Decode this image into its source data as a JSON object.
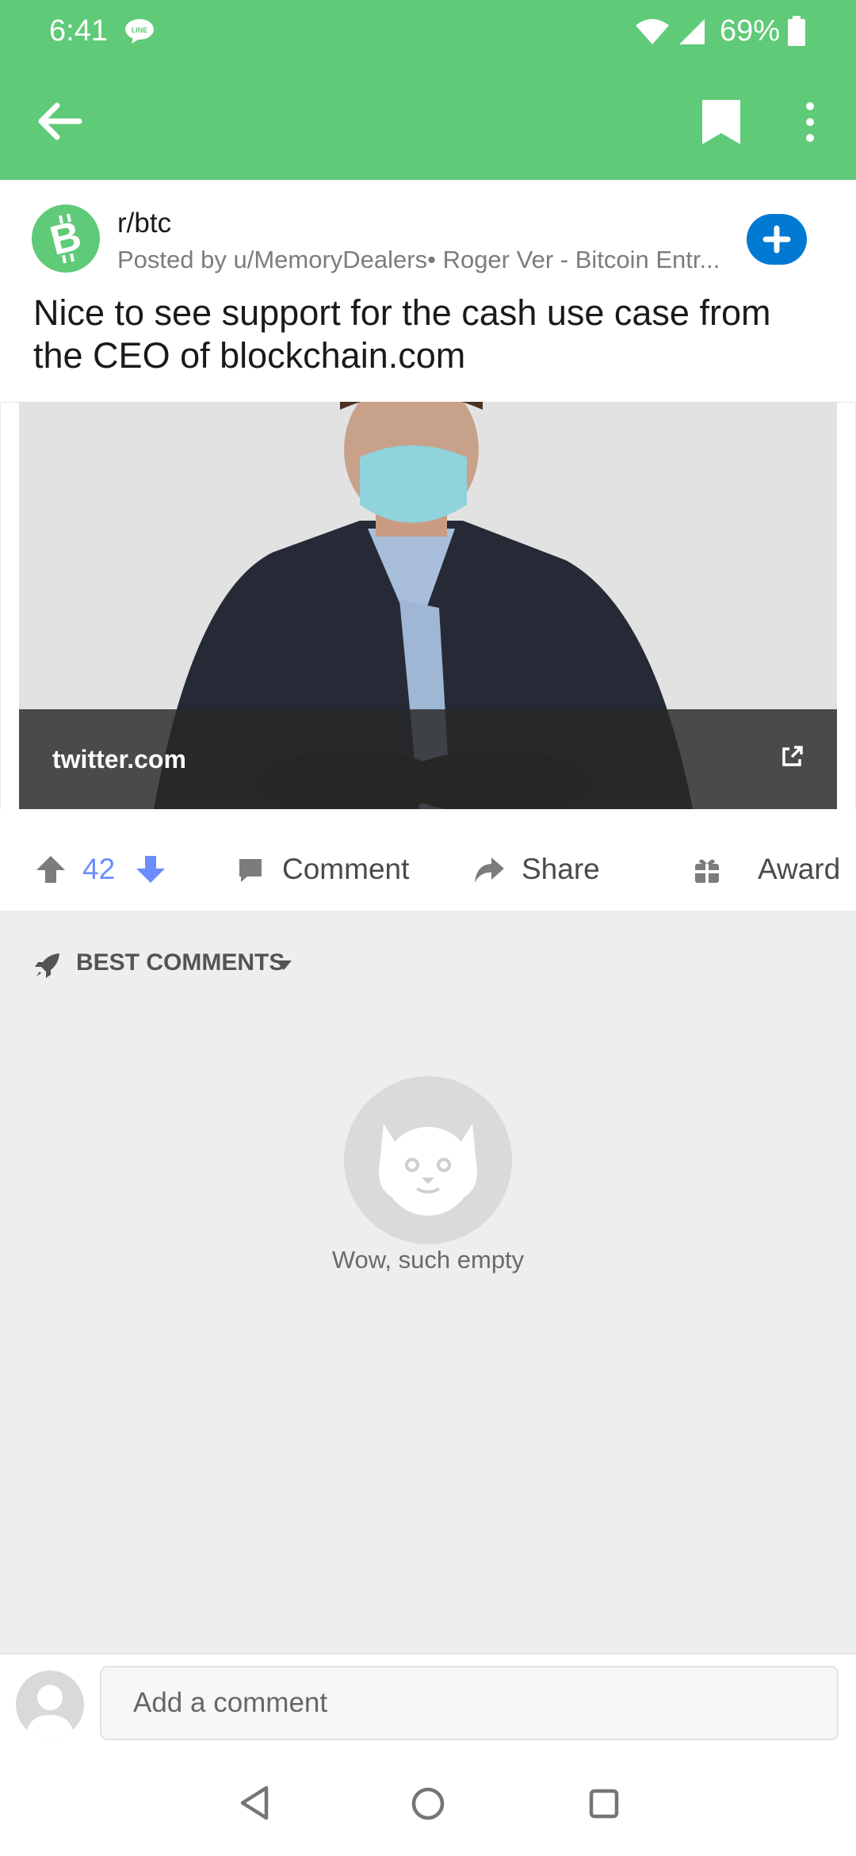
{
  "status_bar": {
    "time": "6:41",
    "battery": "69%",
    "icons": [
      "line-icon",
      "wifi-icon",
      "signal-icon",
      "battery-icon"
    ]
  },
  "toolbar": {
    "icons": [
      "back-arrow-icon",
      "bookmark-icon",
      "more-vert-icon"
    ],
    "accent_color": "#5fca78"
  },
  "post": {
    "subreddit": "r/btc",
    "meta": "Posted by u/MemoryDealers• Roger Ver - Bitcoin Entr...",
    "title": "Nice to see support for the cash use case from the CEO of blockchain.com",
    "link_domain": "twitter.com",
    "vote_count": "42",
    "vote_color": "#6b8dff",
    "join_color": "#0079d3"
  },
  "actions": {
    "comment_label": "Comment",
    "share_label": "Share",
    "award_label": "Award"
  },
  "comments": {
    "sort_label": "BEST COMMENTS",
    "empty_text": "Wow, such empty"
  },
  "comment_input": {
    "placeholder": "Add a comment"
  },
  "nav": {
    "icons": [
      "nav-back-icon",
      "nav-home-icon",
      "nav-recent-icon"
    ]
  }
}
